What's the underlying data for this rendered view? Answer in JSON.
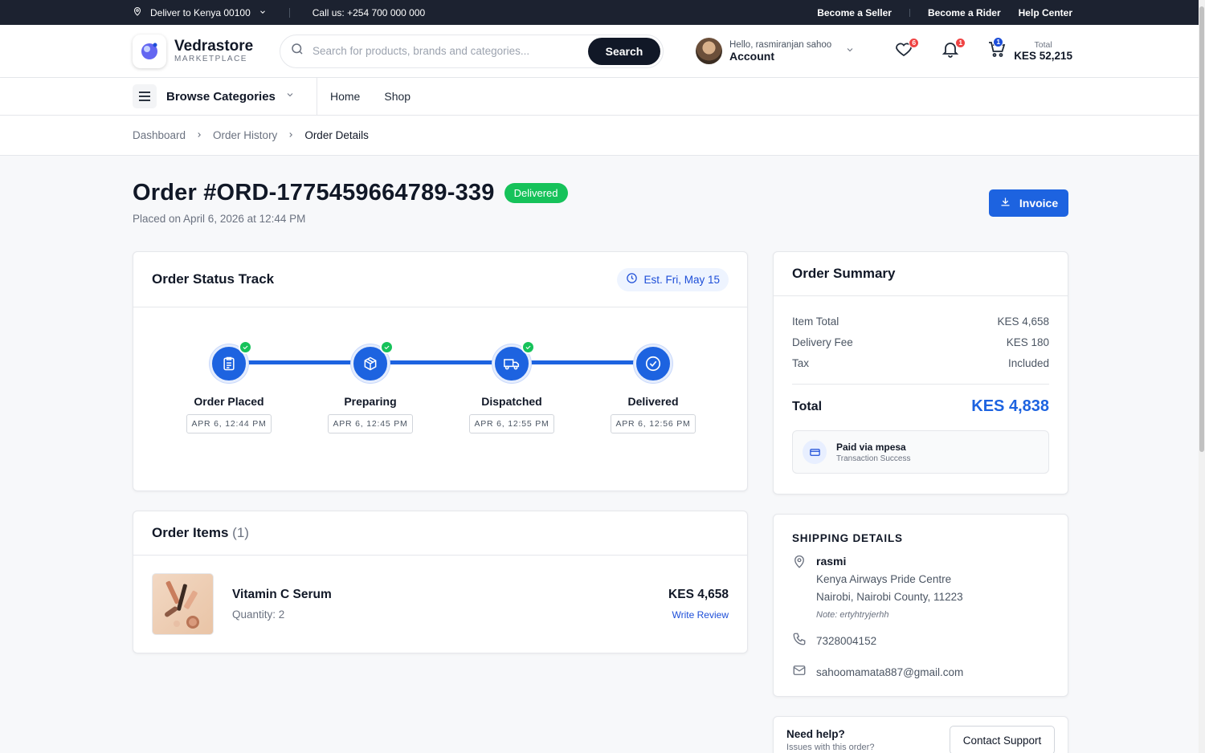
{
  "topbar": {
    "deliver": "Deliver to Kenya 00100",
    "call": "Call us: +254 700 000 000",
    "links": [
      "Become a Seller",
      "Become a Rider",
      "Help Center"
    ]
  },
  "header": {
    "brand": "Vedrastore",
    "brand_sub": "MARKETPLACE",
    "search_placeholder": "Search for products, brands and categories...",
    "search_button": "Search",
    "greeting": "Hello, rasmiranjan sahoo",
    "account": "Account",
    "wishlist_count": "6",
    "notif_count": "1",
    "cart_count": "1",
    "total_label": "Total",
    "total_value": "KES 52,215"
  },
  "nav": {
    "browse": "Browse Categories",
    "links": [
      "Home",
      "Shop"
    ]
  },
  "breadcrumb": [
    "Dashboard",
    "Order History",
    "Order Details"
  ],
  "order": {
    "title": "Order #ORD-1775459664789-339",
    "status": "Delivered",
    "placed": "Placed on April 6, 2026 at 12:44 PM",
    "invoice": "Invoice"
  },
  "track": {
    "title": "Order Status Track",
    "est": "Est. Fri, May 15",
    "steps": [
      {
        "name": "Order Placed",
        "time": "APR 6, 12:44 PM",
        "icon": "clipboard-icon"
      },
      {
        "name": "Preparing",
        "time": "APR 6, 12:45 PM",
        "icon": "box-icon"
      },
      {
        "name": "Dispatched",
        "time": "APR 6, 12:55 PM",
        "icon": "truck-icon"
      },
      {
        "name": "Delivered",
        "time": "APR 6, 12:56 PM",
        "icon": "check-circle-icon"
      }
    ]
  },
  "items": {
    "title": "Order Items",
    "count": "(1)",
    "list": [
      {
        "name": "Vitamin C Serum",
        "qty": "Quantity: 2",
        "price": "KES 4,658",
        "review": "Write Review"
      }
    ]
  },
  "summary": {
    "title": "Order Summary",
    "rows": [
      {
        "label": "Item Total",
        "value": "KES 4,658"
      },
      {
        "label": "Delivery Fee",
        "value": "KES 180"
      },
      {
        "label": "Tax",
        "value": "Included"
      }
    ],
    "total_label": "Total",
    "total_value": "KES 4,838",
    "paid": "Paid via mpesa",
    "paid_sub": "Transaction Success"
  },
  "shipping": {
    "title": "SHIPPING DETAILS",
    "name": "rasmi",
    "line1": "Kenya Airways Pride Centre",
    "line2": "Nairobi, Nairobi County, 11223",
    "note": "Note: ertyhtryjerhh",
    "phone": "7328004152",
    "email": "sahoomamata887@gmail.com"
  },
  "help": {
    "title": "Need help?",
    "sub": "Issues with this order?",
    "button": "Contact Support"
  },
  "colors": {
    "primary": "#1d63e0",
    "success": "#16c25a",
    "dark": "#1c2230"
  }
}
